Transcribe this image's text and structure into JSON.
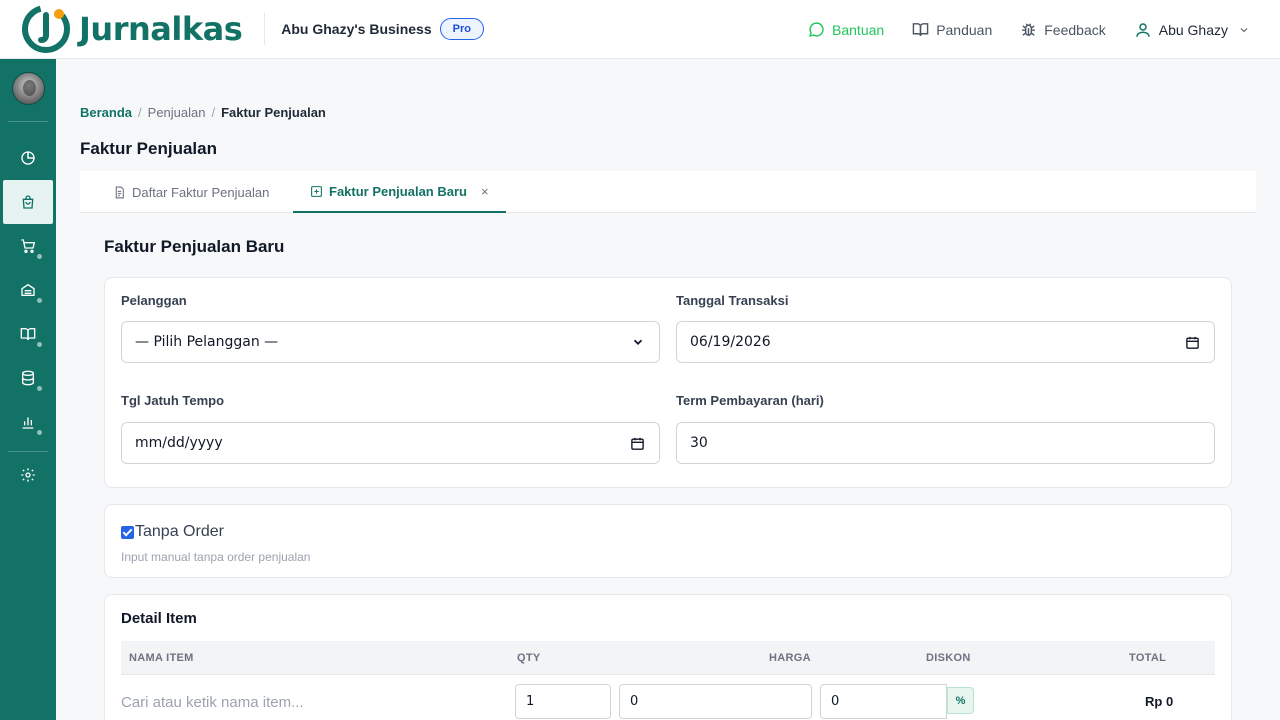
{
  "app": {
    "name": "Jurnalkas",
    "business": "Abu Ghazy's Business",
    "plan_badge": "Pro"
  },
  "topnav": {
    "help": "Bantuan",
    "guide": "Panduan",
    "feedback": "Feedback",
    "user": "Abu Ghazy"
  },
  "sidebar": {
    "items": [
      "dashboard-icon",
      "sales-icon",
      "purchases-icon",
      "inventory-icon",
      "ledger-icon",
      "database-icon",
      "reports-icon",
      "settings-icon"
    ],
    "active": "sales-icon"
  },
  "breadcrumb": {
    "home": "Beranda",
    "section": "Penjualan",
    "current": "Faktur Penjualan"
  },
  "page_title": "Faktur Penjualan",
  "tabs": [
    {
      "label": "Daftar Faktur Penjualan"
    },
    {
      "label": "Faktur Penjualan Baru",
      "close": "×"
    }
  ],
  "form": {
    "title": "Faktur Penjualan Baru",
    "customer_label": "Pelanggan",
    "customer_value": "— Pilih Pelanggan —",
    "date_label": "Tanggal Transaksi",
    "date_value": "06/19/2026",
    "due_label": "Tgl Jatuh Tempo",
    "due_placeholder": "mm/dd/yyyy",
    "term_label": "Term Pembayaran (hari)",
    "term_value": "30",
    "no_order_label": "Tanpa Order",
    "no_order_hint": "Input manual tanpa order penjualan"
  },
  "detail": {
    "title": "Detail Item",
    "columns": [
      "NAMA ITEM",
      "QTY",
      "HARGA",
      "DISKON",
      "TOTAL"
    ],
    "row": {
      "item_placeholder": "Cari atau ketik nama item...",
      "qty": "1",
      "price": "0",
      "discount": "0",
      "discount_unit": "%",
      "total": "Rp 0"
    }
  },
  "colors": {
    "primary": "#127266",
    "accent": "#f59e0b",
    "help": "#22c55e",
    "badge": "#2563eb"
  }
}
